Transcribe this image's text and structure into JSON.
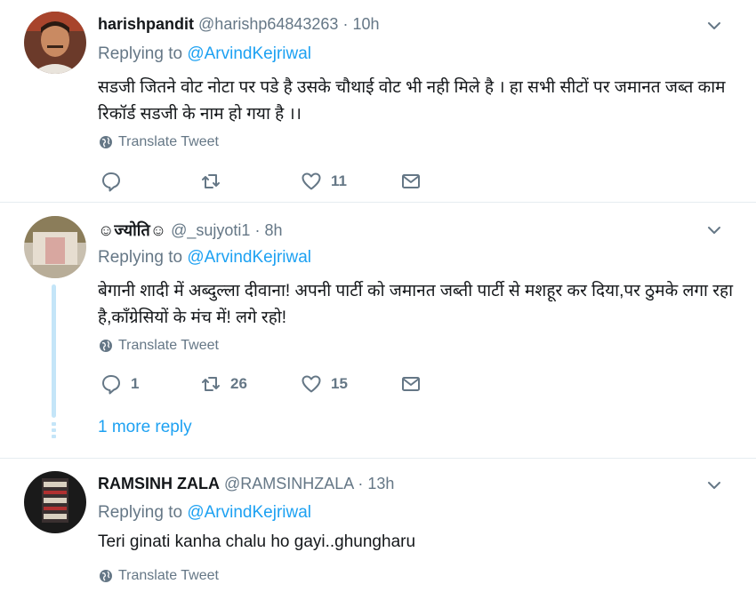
{
  "tweets": [
    {
      "name": "harishpandit",
      "handle": "@harishp64843263",
      "separator": "·",
      "time": "10h",
      "replying_prefix": "Replying to",
      "replying_to": "@ArvindKejriwal",
      "text": "सडजी जितने वोट नोटा पर पडे है उसके चौथाई वोट भी नही मिले है । हा सभी सीटों पर जमानत जब्त काम रिकॉर्ड सडजी के नाम हो गया है ।।",
      "translate": "Translate Tweet",
      "replies": "",
      "retweets": "",
      "likes": "11"
    },
    {
      "name": "☺ज्योति☺",
      "handle": "@_sujyoti1",
      "separator": "·",
      "time": "8h",
      "replying_prefix": "Replying to",
      "replying_to": "@ArvindKejriwal",
      "text": "बेगानी शादी में अब्दुल्ला दीवाना! अपनी पार्टी को जमानत जब्ती पार्टी से मशहूर कर दिया,पर ठुमके लगा रहा है,कॉंग्रेसियों के मंच में! लगे रहो!",
      "translate": "Translate Tweet",
      "replies": "1",
      "retweets": "26",
      "likes": "15",
      "more_replies": "1 more reply"
    },
    {
      "name": "RAMSINH ZALA",
      "handle": "@RAMSINHZALA",
      "separator": "·",
      "time": "13h",
      "replying_prefix": "Replying to",
      "replying_to": "@ArvindKejriwal",
      "text": "Teri ginati kanha chalu ho gayi..ghungharu",
      "translate": "Translate Tweet"
    }
  ],
  "colors": {
    "accent": "#1da1f2",
    "muted": "#657786",
    "text": "#14171a",
    "divider": "#e6ecf0",
    "thread": "#c4e5f8"
  }
}
